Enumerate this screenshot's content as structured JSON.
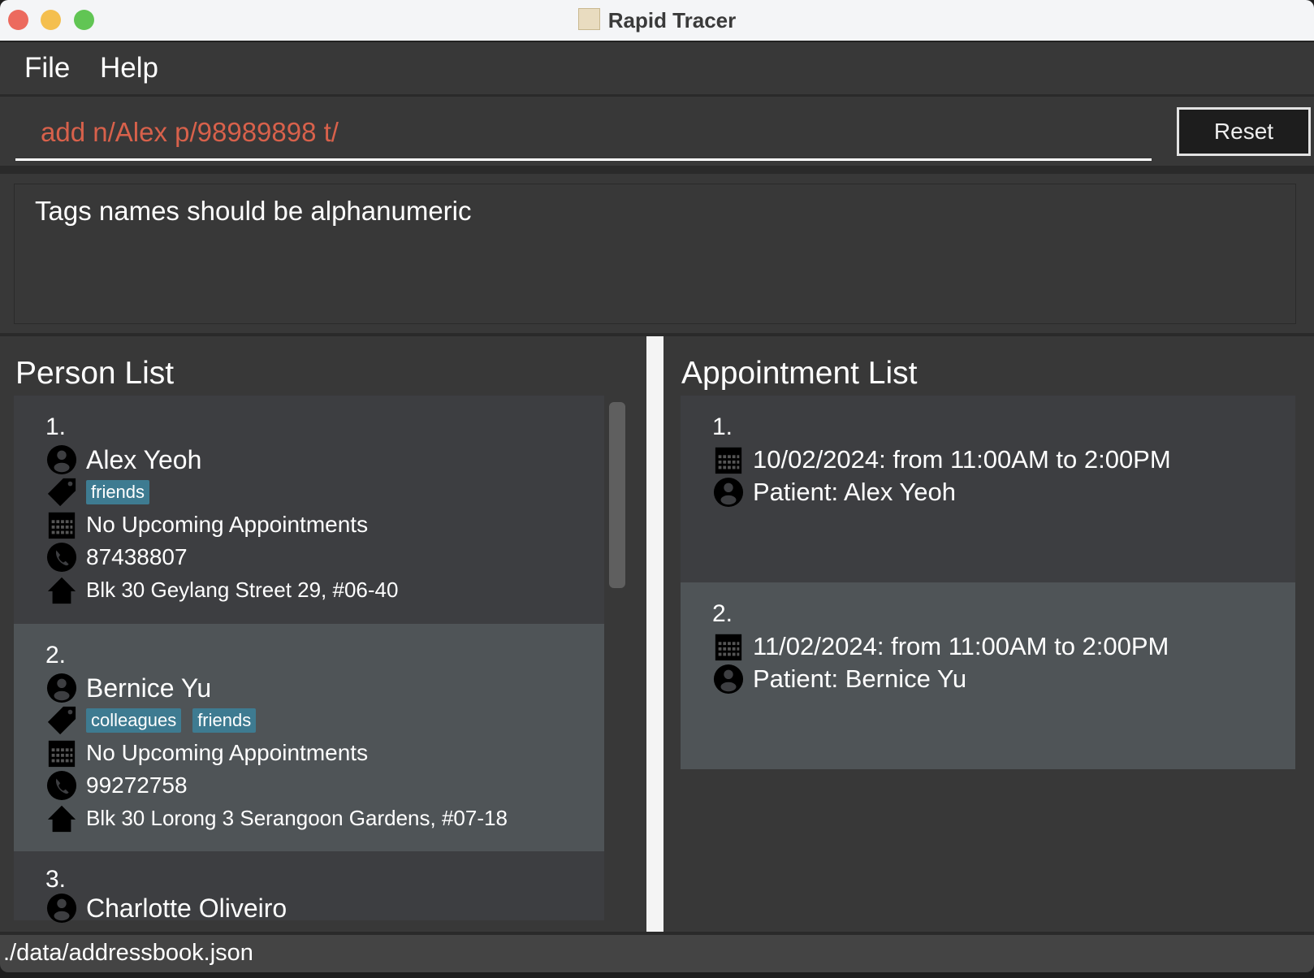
{
  "window": {
    "title": "Rapid Tracer"
  },
  "menu": {
    "file": "File",
    "help": "Help"
  },
  "command": {
    "value": "add n/Alex p/98989898 t/",
    "reset_label": "Reset"
  },
  "result": {
    "message": "Tags names should be alphanumeric"
  },
  "person_list": {
    "title": "Person List",
    "items": [
      {
        "index": "1.",
        "name": "Alex Yeoh",
        "tags": [
          "friends"
        ],
        "appointment": "No Upcoming Appointments",
        "phone": "87438807",
        "address": "Blk 30 Geylang Street 29, #06-40"
      },
      {
        "index": "2.",
        "name": "Bernice Yu",
        "tags": [
          "colleagues",
          "friends"
        ],
        "appointment": "No Upcoming Appointments",
        "phone": "99272758",
        "address": "Blk 30 Lorong 3 Serangoon Gardens, #07-18"
      },
      {
        "index": "3.",
        "name": "Charlotte Oliveiro"
      }
    ]
  },
  "appointment_list": {
    "title": "Appointment List",
    "items": [
      {
        "index": "1.",
        "time": "10/02/2024: from 11:00AM to 2:00PM",
        "patient": "Patient: Alex Yeoh"
      },
      {
        "index": "2.",
        "time": "11/02/2024: from 11:00AM to 2:00PM",
        "patient": "Patient: Bernice Yu"
      }
    ]
  },
  "status": {
    "path": "./data/addressbook.json"
  },
  "colors": {
    "command_text": "#d8614b",
    "tag": "#3e7b91",
    "background": "#383838"
  }
}
